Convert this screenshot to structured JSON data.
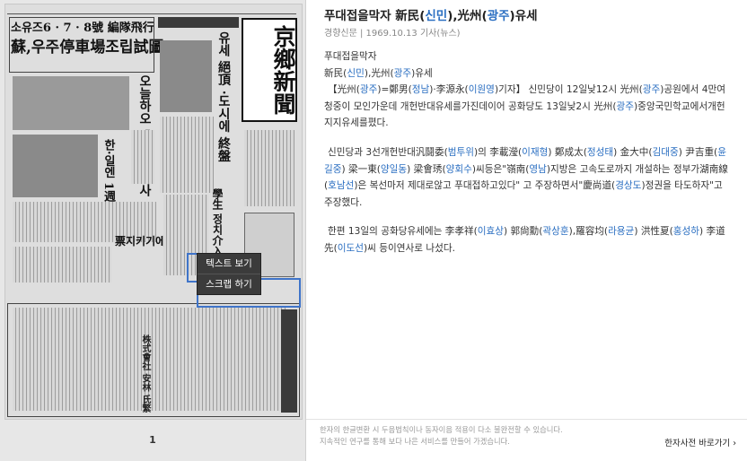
{
  "viewer": {
    "page_number": "1",
    "logo_text": "京鄉新聞",
    "context_menu": {
      "text_view": "텍스트 보기",
      "scrap": "스크랩 하기"
    }
  },
  "article": {
    "title": {
      "parts": [
        {
          "t": "푸대접을막자 新民("
        },
        {
          "t": "신민",
          "hg": true
        },
        {
          "t": "),光州("
        },
        {
          "t": "광주",
          "hg": true
        },
        {
          "t": ")유세"
        }
      ]
    },
    "meta": "경향신문 | 1969.10.13 기사(뉴스)",
    "paragraphs": [
      [
        {
          "t": "푸대접을막자"
        }
      ],
      [
        {
          "t": "新民("
        },
        {
          "t": "신민",
          "hg": true
        },
        {
          "t": "),光州("
        },
        {
          "t": "광주",
          "hg": true
        },
        {
          "t": ")유세"
        }
      ],
      [
        {
          "t": "【光州("
        },
        {
          "t": "광주",
          "hg": true
        },
        {
          "t": ")=鄭男("
        },
        {
          "t": "정남",
          "hg": true
        },
        {
          "t": ")·李源永("
        },
        {
          "t": "이원영",
          "hg": true
        },
        {
          "t": ")기자】 신민당이 12일낮12시 光州("
        },
        {
          "t": "광주",
          "hg": true
        },
        {
          "t": ")공원에서 4만여청중이 모인가운데 개헌반대유세를가진데이어 공화당도 13일낮2시 光州("
        },
        {
          "t": "광주",
          "hg": true
        },
        {
          "t": ")중앙국민학교에서개헌지지유세를폈다."
        }
      ],
      [
        {
          "t": "신민당과 3선개헌반대汎鬪委("
        },
        {
          "t": "범투위",
          "hg": true
        },
        {
          "t": ")의 李載瀅("
        },
        {
          "t": "이재형",
          "hg": true
        },
        {
          "t": ") 鄭成太("
        },
        {
          "t": "정성태",
          "hg": true
        },
        {
          "t": ") 金大中("
        },
        {
          "t": "김대중",
          "hg": true
        },
        {
          "t": ") 尹吉重("
        },
        {
          "t": "윤길중",
          "hg": true
        },
        {
          "t": ") 梁一東("
        },
        {
          "t": "양일동",
          "hg": true
        },
        {
          "t": ") 梁會琇("
        },
        {
          "t": "양회수",
          "hg": true
        },
        {
          "t": ")씨등은\"嶺南("
        },
        {
          "t": "영남",
          "hg": true
        },
        {
          "t": ")지방은 고속도로까지 개설하는 정부가湖南線("
        },
        {
          "t": "호남선",
          "hg": true
        },
        {
          "t": ")은 복선마저 제대로않고 푸대접하고있다\" 고 주장하면서\"慶尚道("
        },
        {
          "t": "경상도",
          "hg": true
        },
        {
          "t": ")정권을 타도하자\"고 주장했다."
        }
      ],
      [
        {
          "t": "한편 13일의 공화당유세에는 李孝祥("
        },
        {
          "t": "이효상",
          "hg": true
        },
        {
          "t": ") 郭尙勳("
        },
        {
          "t": "곽상훈",
          "hg": true
        },
        {
          "t": "),羅容均("
        },
        {
          "t": "라용균",
          "hg": true
        },
        {
          "t": ") 洪性夏("
        },
        {
          "t": "홍성하",
          "hg": true
        },
        {
          "t": ") 李道先("
        },
        {
          "t": "이도선",
          "hg": true
        },
        {
          "t": ")씨 등이연사로 나섰다."
        }
      ]
    ],
    "footer": {
      "note_line1": "한자의 한글변환 시 두음법칙이나 동자이음 적용이 다소 불완전할 수 있습니다.",
      "note_line2": "지속적인 연구를 통해 보다 나은 서비스를 만들어 가겠습니다.",
      "dict_button": "한자사전 바로가기 ›"
    }
  },
  "colors": {
    "hangul_gloss": "#2b6fc2",
    "selection": "#3f74c9",
    "menu_bg": "#3b3b3b"
  }
}
